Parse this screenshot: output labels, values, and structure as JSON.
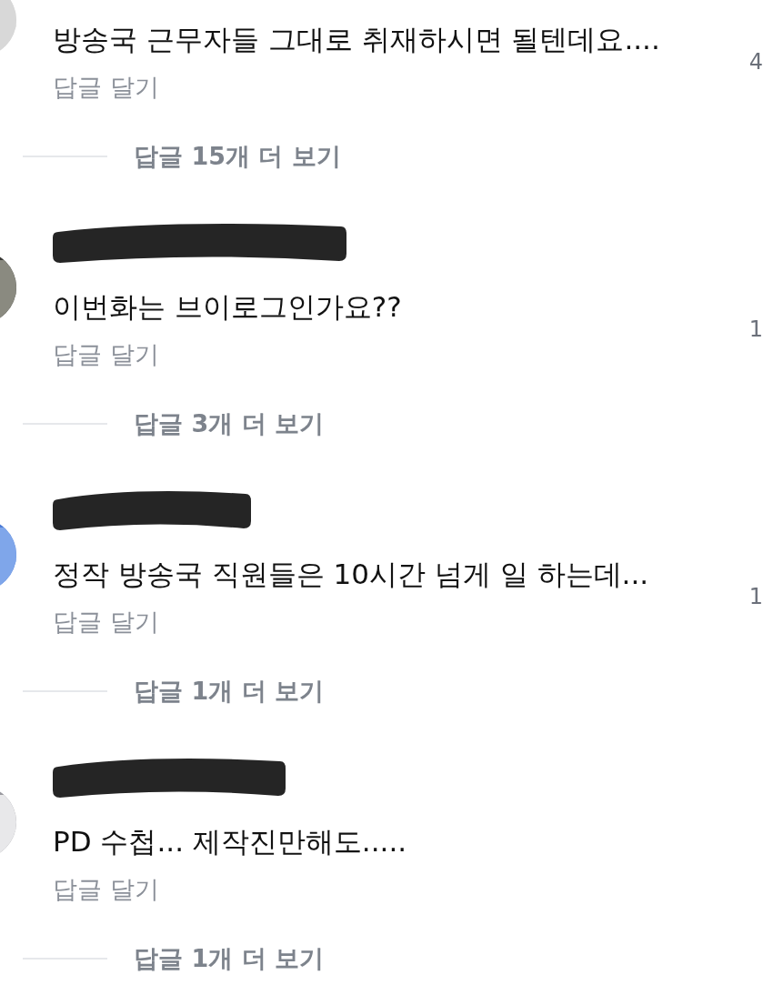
{
  "comments": [
    {
      "redacted": false,
      "text": "방송국 근무자들 그대로 취재하시면 될텐데요....",
      "reply_link": "답글 달기",
      "like_count": "4",
      "more_replies": "답글 15개 더 보기"
    },
    {
      "redacted": true,
      "text": "이번화는 브이로그인가요??",
      "reply_link": "답글 달기",
      "like_count": "1",
      "more_replies": "답글 3개 더 보기"
    },
    {
      "redacted": true,
      "text": "정작 방송국 직원들은 10시간 넘게 일 하는데...",
      "reply_link": "답글 달기",
      "like_count": "1",
      "more_replies": "답글 1개 더 보기"
    },
    {
      "redacted": true,
      "text": "PD 수첩... 제작진만해도.....",
      "reply_link": "답글 달기",
      "more_replies": "답글 1개 더 보기"
    }
  ]
}
